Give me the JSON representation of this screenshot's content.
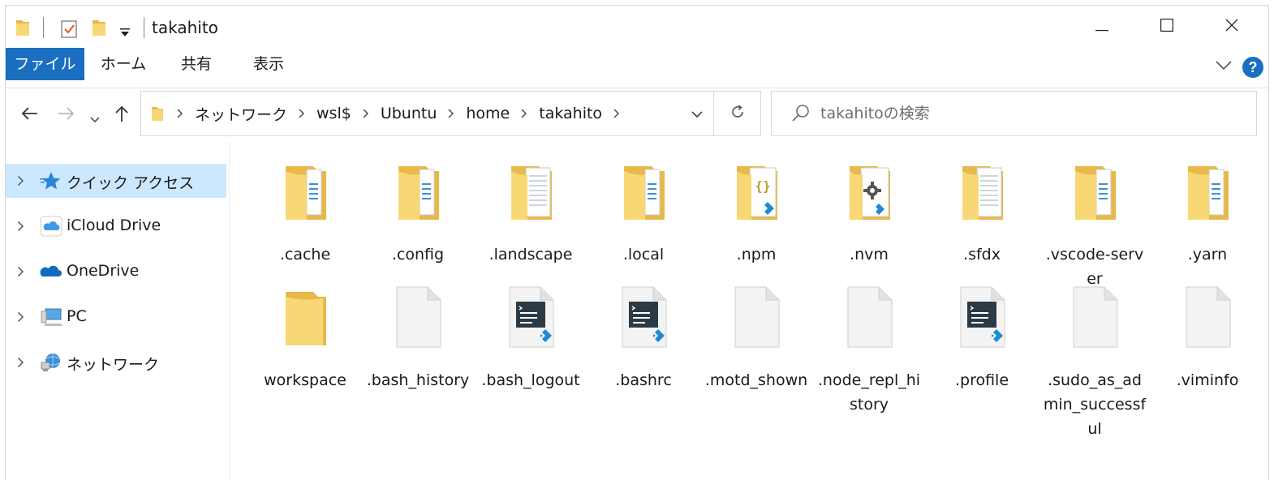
{
  "window": {
    "title": "takahito",
    "controls": {
      "minimize": "minimize",
      "maximize": "maximize",
      "close": "close"
    }
  },
  "ribbon": {
    "tabs": [
      "ファイル",
      "ホーム",
      "共有",
      "表示"
    ],
    "help_label": "?"
  },
  "address": {
    "crumbs": [
      "ネットワーク",
      "wsl$",
      "Ubuntu",
      "home",
      "takahito"
    ]
  },
  "search": {
    "placeholder": "takahitoの検索"
  },
  "sidebar": {
    "items": [
      {
        "label": "クイック アクセス",
        "icon": "star-icon",
        "selected": true
      },
      {
        "label": "iCloud Drive",
        "icon": "icloud-icon",
        "selected": false
      },
      {
        "label": "OneDrive",
        "icon": "onedrive-cloud-icon",
        "selected": false
      },
      {
        "label": "PC",
        "icon": "pc-icon",
        "selected": false
      },
      {
        "label": "ネットワーク",
        "icon": "network-icon",
        "selected": false
      }
    ]
  },
  "files": [
    {
      "name": ".cache",
      "icon": "folder-with-files-icon"
    },
    {
      "name": ".config",
      "icon": "folder-with-files-icon"
    },
    {
      "name": ".landscape",
      "icon": "folder-with-document-icon"
    },
    {
      "name": ".local",
      "icon": "folder-with-files-icon"
    },
    {
      "name": ".npm",
      "icon": "folder-json-icon"
    },
    {
      "name": ".nvm",
      "icon": "folder-settings-icon"
    },
    {
      "name": ".sfdx",
      "icon": "folder-with-document-icon"
    },
    {
      "name": ".vscode-server",
      "icon": "folder-with-files-icon"
    },
    {
      "name": ".yarn",
      "icon": "folder-with-files-icon"
    },
    {
      "name": "workspace",
      "icon": "folder-empty-icon"
    },
    {
      "name": ".bash_history",
      "icon": "blank-file-icon"
    },
    {
      "name": ".bash_logout",
      "icon": "vscode-shell-file-icon"
    },
    {
      "name": ".bashrc",
      "icon": "vscode-shell-file-icon"
    },
    {
      "name": ".motd_shown",
      "icon": "blank-file-icon"
    },
    {
      "name": ".node_repl_history",
      "icon": "blank-file-icon"
    },
    {
      "name": ".profile",
      "icon": "vscode-shell-file-icon"
    },
    {
      "name": ".sudo_as_admin_successful",
      "icon": "blank-file-icon"
    },
    {
      "name": ".viminfo",
      "icon": "blank-file-icon"
    }
  ],
  "colors": {
    "accent": "#1a6fc1",
    "selected": "#cce8ff",
    "folder": "#f8d775",
    "folder_dark": "#e8b94a"
  }
}
